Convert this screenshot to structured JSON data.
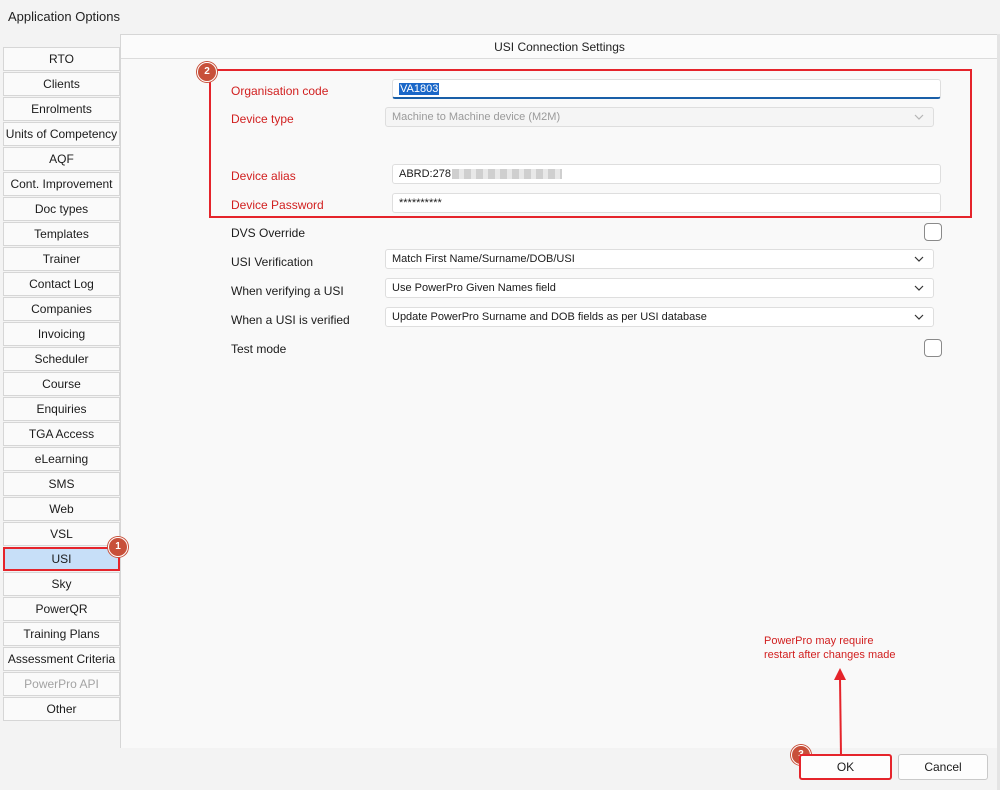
{
  "window": {
    "title": "Application Options"
  },
  "sidebar": {
    "items": [
      {
        "label": "RTO"
      },
      {
        "label": "Clients"
      },
      {
        "label": "Enrolments"
      },
      {
        "label": "Units of Competency"
      },
      {
        "label": "AQF"
      },
      {
        "label": "Cont. Improvement"
      },
      {
        "label": "Doc types"
      },
      {
        "label": "Templates"
      },
      {
        "label": "Trainer"
      },
      {
        "label": "Contact Log"
      },
      {
        "label": "Companies"
      },
      {
        "label": "Invoicing"
      },
      {
        "label": "Scheduler"
      },
      {
        "label": "Course"
      },
      {
        "label": "Enquiries"
      },
      {
        "label": "TGA Access"
      },
      {
        "label": "eLearning"
      },
      {
        "label": "SMS"
      },
      {
        "label": "Web"
      },
      {
        "label": "VSL"
      },
      {
        "label": "USI"
      },
      {
        "label": "Sky"
      },
      {
        "label": "PowerQR"
      },
      {
        "label": "Training Plans"
      },
      {
        "label": "Assessment Criteria"
      },
      {
        "label": "PowerPro API"
      },
      {
        "label": "Other"
      }
    ]
  },
  "panel": {
    "header": "USI Connection Settings",
    "organisation_code": {
      "label": "Organisation code",
      "value": "VA1803"
    },
    "device_type": {
      "label": "Device type",
      "value": "Machine to Machine device (M2M)"
    },
    "device_alias": {
      "label": "Device alias",
      "value": "ABRD:278"
    },
    "device_password": {
      "label": "Device Password",
      "value": "**********"
    },
    "dvs_override": {
      "label": "DVS Override"
    },
    "usi_verification": {
      "label": "USI Verification",
      "value": "Match First Name/Surname/DOB/USI"
    },
    "when_verifying": {
      "label": "When verifying a USI",
      "value": "Use PowerPro Given Names field"
    },
    "when_verified": {
      "label": "When a USI is verified",
      "value": "Update PowerPro Surname and DOB fields as per USI database"
    },
    "test_mode": {
      "label": "Test mode"
    }
  },
  "annotations": {
    "badge1": "1",
    "badge2": "2",
    "badge3": "3",
    "note_line1": "PowerPro may require",
    "note_line2": "restart after changes made",
    "colors": {
      "highlight": "#e5242b",
      "badge": "#c8503a"
    }
  },
  "buttons": {
    "ok": "OK",
    "cancel": "Cancel"
  }
}
